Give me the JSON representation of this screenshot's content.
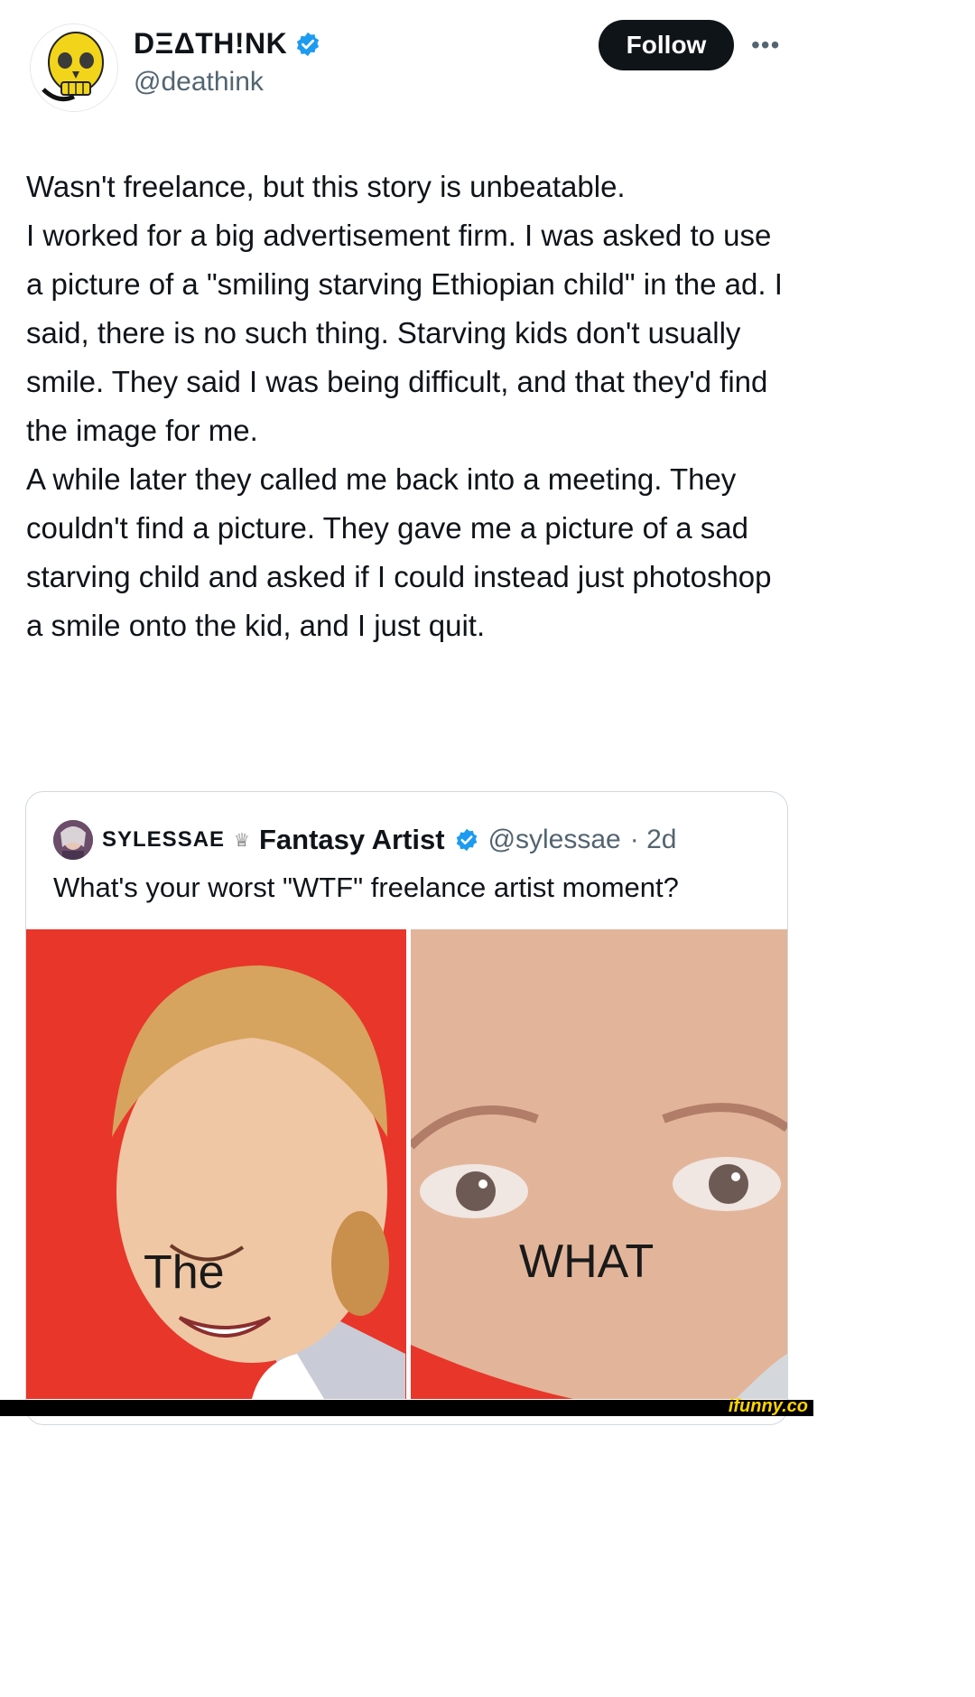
{
  "author": {
    "display_name": "DΞΔTH!NK",
    "handle": "@deathink",
    "verified": true
  },
  "actions": {
    "follow_label": "Follow",
    "more_icon": "more-horizontal-icon"
  },
  "post": {
    "paragraphs": [
      "Wasn't freelance, but this story is unbeatable.",
      "I worked for a big advertisement firm. I was asked to use a picture of a \"smiling starving Ethiopian child\" in the ad. I said, there is no such thing. Starving kids don't usually smile. They said I was being difficult, and that they'd find the image for me.",
      "A while later they called me back into a meeting. They couldn't find a picture. They gave me a picture of a sad starving child and asked if I could instead just photoshop a smile onto the kid, and I just quit."
    ]
  },
  "quoted_post": {
    "name_prefix": "SYLESSAE",
    "crown_icon": "♕",
    "name": "Fantasy Artist",
    "handle": "@sylessae",
    "time": "· 2d",
    "text": "What's your worst \"WTF\" freelance artist moment?",
    "image_captions": [
      "The",
      "WHAT"
    ]
  },
  "footer": {
    "watermark": "ifunny.co"
  },
  "colors": {
    "text": "#0f1419",
    "secondary": "#536471",
    "verified_blue": "#1d9bf0",
    "follow_bg": "#0f1419",
    "left_image_bg": "#e8362a"
  }
}
